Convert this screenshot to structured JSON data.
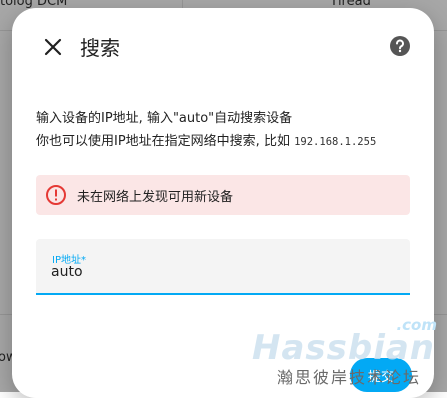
{
  "background": {
    "top_left_text": "tolog  DCM",
    "top_right_text": "Tlread",
    "left_edge_text": "ow"
  },
  "dialog": {
    "title": "搜索",
    "close_icon": "close-icon",
    "help_icon": "help-circle-icon",
    "description": {
      "line1": "输入设备的IP地址, 输入\"auto\"自动搜索设备",
      "line2_prefix": "你也可以使用IP地址在指定网络中搜索, 比如",
      "line2_example": "192.168.1.255"
    },
    "alert": {
      "icon": "alert-circle-icon",
      "text": "未在网络上发现可用新设备",
      "color": "#e53935"
    },
    "ip_field": {
      "label": "IP地址*",
      "value": "auto"
    },
    "submit_label": "提交",
    "accent_color": "#03a9f4"
  },
  "watermark": {
    "brand": "Hassbian",
    "suffix": ".com",
    "subtitle": "瀚思彼岸技术论坛"
  }
}
